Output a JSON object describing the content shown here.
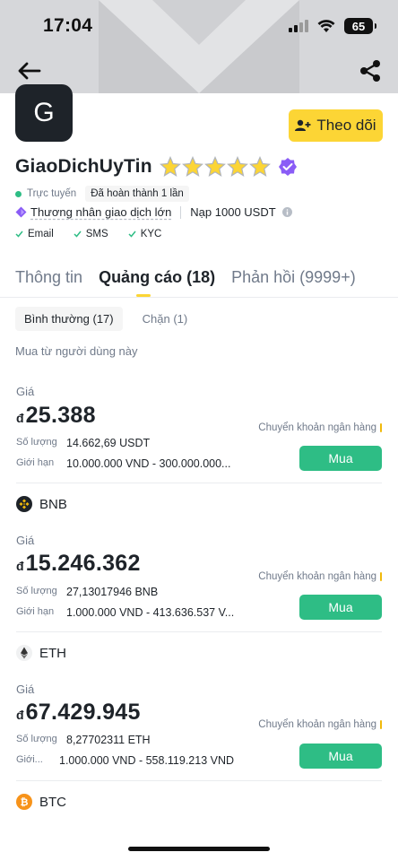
{
  "status_bar": {
    "time": "17:04",
    "battery": "65"
  },
  "profile": {
    "avatar_letter": "G",
    "name": "GiaoDichUyTin",
    "star_count": 5,
    "follow_label": "Theo dõi",
    "online": "Trực tuyến",
    "completed": "Đã hoàn thành 1 lần",
    "merchant": "Thương nhân giao dịch lớn",
    "deposit": "Nạp 1000 USDT",
    "verifications": [
      "Email",
      "SMS",
      "KYC"
    ]
  },
  "tabs": [
    {
      "label": "Thông tin",
      "active": false
    },
    {
      "label": "Quảng cáo (18)",
      "active": true
    },
    {
      "label": "Phản hồi (9999+)",
      "active": false
    }
  ],
  "subtabs": [
    {
      "label": "Bình thường (17)",
      "active": true
    },
    {
      "label": "Chặn (1)",
      "active": false
    }
  ],
  "buy_from_label": "Mua từ người dùng này",
  "ads": [
    {
      "coin": "",
      "price_label": "Giá",
      "currency": "đ",
      "price": "25.388",
      "qty_label": "Số lượng",
      "qty": "14.662,69 USDT",
      "limit_label": "Giới hạn",
      "limit": "10.000.000 VND - 300.000.000...",
      "payment": "Chuyển khoản ngân hàng",
      "buy_label": "Mua"
    },
    {
      "coin": "BNB",
      "price_label": "Giá",
      "currency": "đ",
      "price": "15.246.362",
      "qty_label": "Số lượng",
      "qty": "27,13017946 BNB",
      "limit_label": "Giới hạn",
      "limit": "1.000.000 VND - 413.636.537 V...",
      "payment": "Chuyển khoản ngân hàng",
      "buy_label": "Mua"
    },
    {
      "coin": "ETH",
      "price_label": "Giá",
      "currency": "đ",
      "price": "67.429.945",
      "qty_label": "Số lượng",
      "qty": "8,27702311 ETH",
      "limit_label": "Giới...",
      "limit": "1.000.000 VND - 558.119.213 VND",
      "payment": "Chuyển khoản ngân hàng",
      "buy_label": "Mua"
    },
    {
      "coin": "BTC"
    }
  ],
  "colors": {
    "brand_yellow": "#fcd535",
    "buy_green": "#2ebd85",
    "text_primary": "#1e2329",
    "text_secondary": "#707a8a",
    "verified_purple": "#8a5cf6"
  }
}
